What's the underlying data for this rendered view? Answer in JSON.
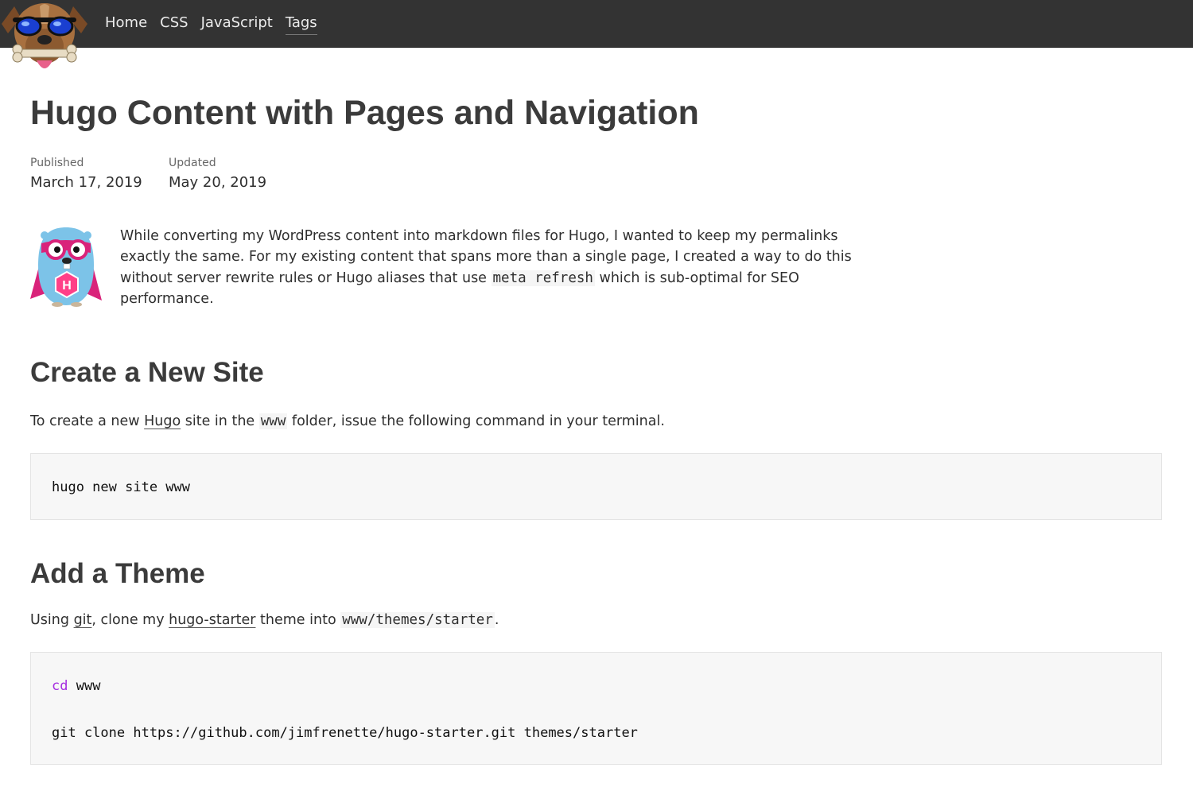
{
  "nav": {
    "items": [
      {
        "label": "Home"
      },
      {
        "label": "CSS"
      },
      {
        "label": "JavaScript"
      },
      {
        "label": "Tags"
      }
    ]
  },
  "article": {
    "title": "Hugo Content with Pages and Navigation",
    "published_label": "Published",
    "published_date": "March 17, 2019",
    "updated_label": "Updated",
    "updated_date": "May 20, 2019",
    "intro_before": "While converting my WordPress content into markdown files for Hugo, I wanted to keep my permalinks exactly the same. For my existing content that spans more than a single page, I created a way to do this without server rewrite rules or Hugo aliases that use ",
    "intro_code": "meta refresh",
    "intro_after": " which is sub-optimal for SEO performance.",
    "section1": {
      "heading": "Create a New Site",
      "text_1": "To create a new ",
      "link_hugo": "Hugo",
      "text_2": " site in the ",
      "code_www": "www",
      "text_3": " folder, issue the following command in your terminal.",
      "code_line": "hugo new site www"
    },
    "section2": {
      "heading": "Add a Theme",
      "text_1": "Using ",
      "link_git": "git",
      "text_2": ", clone my ",
      "link_starter": "hugo-starter",
      "text_3": " theme into ",
      "code_path": "www/themes/starter",
      "text_4": ".",
      "code_cd_kw": "cd",
      "code_cd_arg": " www",
      "code_clone": "git clone https://github.com/jimfrenette/hugo-starter.git themes/starter"
    }
  },
  "colors": {
    "nav_bg": "#333333",
    "code_bg": "#f7f7f7",
    "keyword": "#a52ee0",
    "hugo_pink": "#ff4088",
    "gopher_blue": "#7cc3e8"
  },
  "icons": {
    "logo": "dog-with-sunglasses-and-bone-logo",
    "intro_image": "hugo-gopher-superhero"
  }
}
